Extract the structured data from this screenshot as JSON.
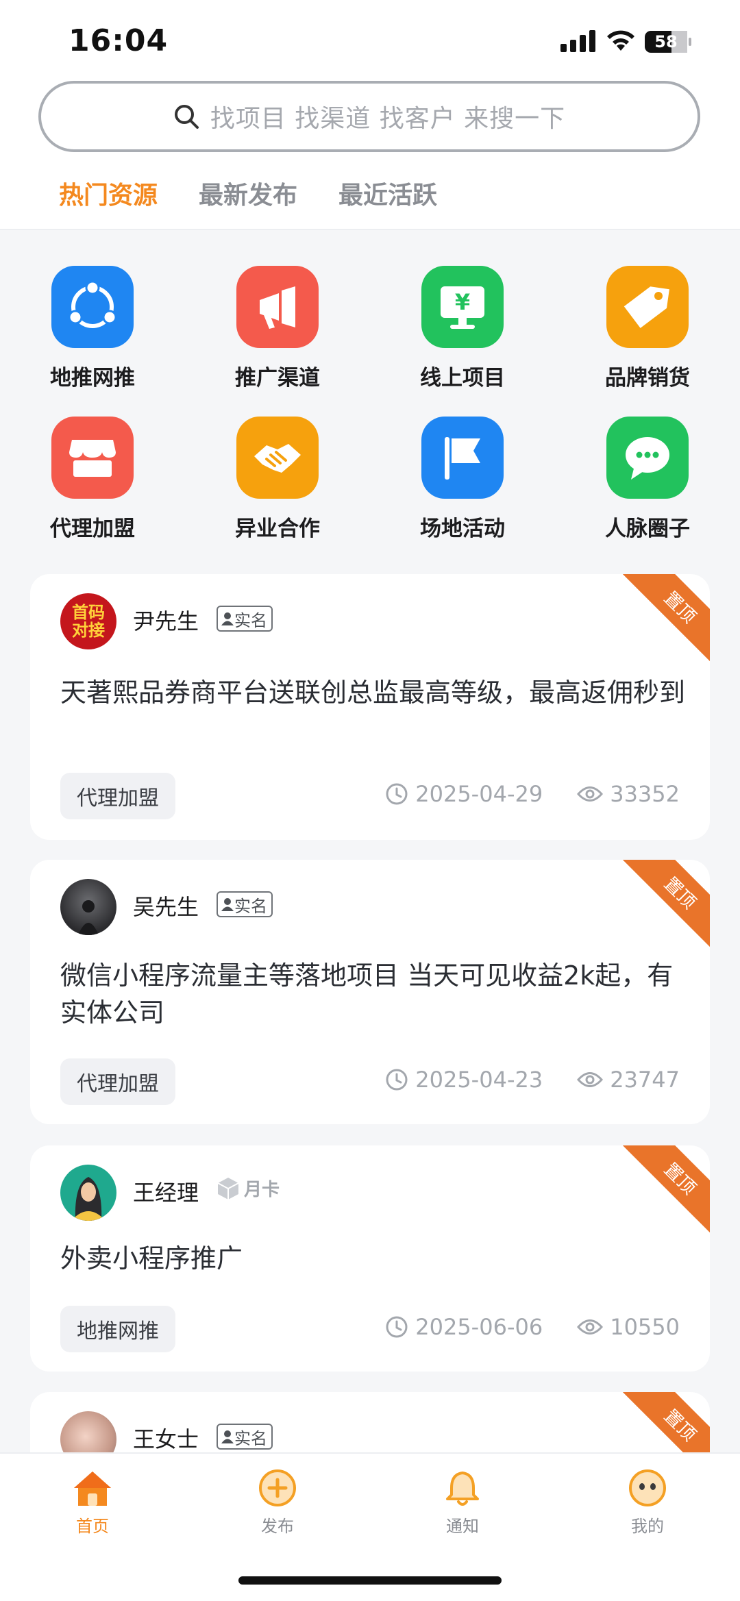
{
  "status_bar": {
    "time": "16:04",
    "battery": "58"
  },
  "search": {
    "placeholder": "找项目 找渠道 找客户 来搜一下"
  },
  "tabs": [
    {
      "label": "热门资源",
      "active": true
    },
    {
      "label": "最新发布",
      "active": false
    },
    {
      "label": "最近活跃",
      "active": false
    }
  ],
  "categories": [
    {
      "label": "地推网推",
      "icon": "share-network-icon",
      "color": "#1f86f2"
    },
    {
      "label": "推广渠道",
      "icon": "megaphone-icon",
      "color": "#f45a4c"
    },
    {
      "label": "线上项目",
      "icon": "yuan-monitor-icon",
      "color": "#22c25d"
    },
    {
      "label": "品牌销货",
      "icon": "price-tag-icon",
      "color": "#f6a10d"
    },
    {
      "label": "代理加盟",
      "icon": "storefront-icon",
      "color": "#f45a4c"
    },
    {
      "label": "异业合作",
      "icon": "handshake-icon",
      "color": "#f6a10d"
    },
    {
      "label": "场地活动",
      "icon": "flag-icon",
      "color": "#1f86f2"
    },
    {
      "label": "人脉圈子",
      "icon": "chat-bubble-icon",
      "color": "#22c25d"
    }
  ],
  "posts": [
    {
      "user": "尹先生",
      "badge": "实名",
      "pinned": "置顶",
      "title": "天著熙品券商平台送联创总监最高等级，最高返佣秒到",
      "tag": "代理加盟",
      "date": "2025-04-29",
      "views": "33352",
      "avatar_text_1": "首码",
      "avatar_text_2": "对接"
    },
    {
      "user": "吴先生",
      "badge": "实名",
      "pinned": "置顶",
      "title": "微信小程序流量主等落地项目 当天可见收益2k起，有实体公司",
      "tag": "代理加盟",
      "date": "2025-04-23",
      "views": "23747"
    },
    {
      "user": "王经理",
      "badge": "月卡",
      "pinned": "置顶",
      "title": "外卖小程序推广",
      "tag": "地推网推",
      "date": "2025-06-06",
      "views": "10550"
    },
    {
      "user": "王女士",
      "badge": "实名",
      "pinned": "置顶"
    }
  ],
  "bottom_nav": [
    {
      "label": "首页",
      "icon": "home-icon",
      "active": true
    },
    {
      "label": "发布",
      "icon": "plus-circle-icon",
      "active": false
    },
    {
      "label": "通知",
      "icon": "bell-icon",
      "active": false
    },
    {
      "label": "我的",
      "icon": "smiley-face-icon",
      "active": false
    }
  ],
  "colors": {
    "accent": "#f4891f",
    "ribbon": "#e9742a"
  }
}
